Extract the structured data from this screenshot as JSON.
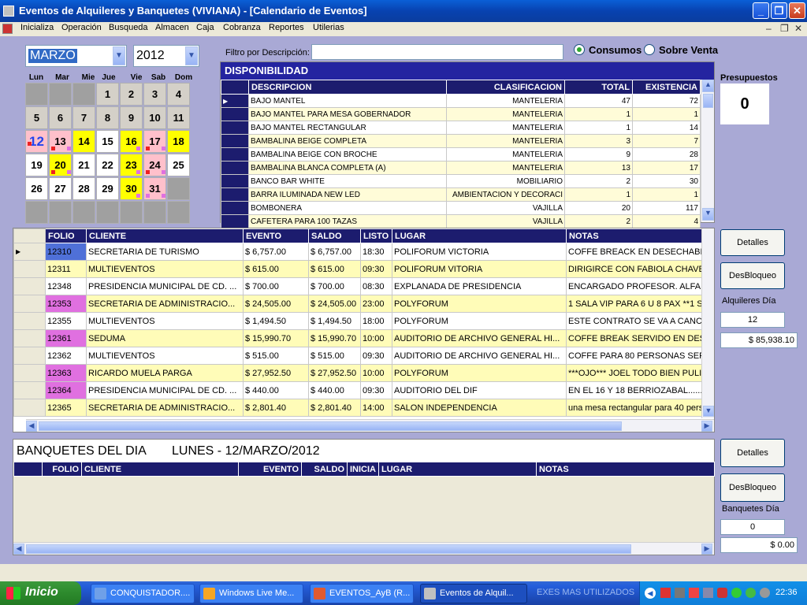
{
  "window": {
    "title": "Eventos de Alquileres y Banquetes  (VIVIANA) - [Calendario de Eventos]",
    "min": "_",
    "max": "❐",
    "close": "✕"
  },
  "menu": [
    "Inicializa",
    "Operación",
    "Busqueda",
    "Almacen",
    "Caja",
    "Cobranza",
    "Reportes",
    "Utilerias"
  ],
  "calendar": {
    "month": "MARZO",
    "year": "2012",
    "weekdays": [
      "Lun",
      "Mar",
      "Mie",
      "Jue",
      "Vie",
      "Sab",
      "Dom"
    ],
    "weeks": [
      [
        "",
        "",
        "",
        "1",
        "2",
        "3",
        "4"
      ],
      [
        "5",
        "6",
        "7",
        "8",
        "9",
        "10",
        "11"
      ],
      [
        "12",
        "13",
        "14",
        "15",
        "16",
        "17",
        "18"
      ],
      [
        "19",
        "20",
        "21",
        "22",
        "23",
        "24",
        "25"
      ],
      [
        "26",
        "27",
        "28",
        "29",
        "30",
        "31",
        ""
      ],
      [
        "",
        "",
        "",
        "",
        "",
        "",
        ""
      ]
    ]
  },
  "filter": {
    "label": "Filtro por Descripción:",
    "value": ""
  },
  "mode": {
    "option1": "Consumos",
    "option2": "Sobre Venta",
    "selected": "Consumos"
  },
  "disponibilidad": {
    "title": "DISPONIBILIDAD",
    "headers": [
      "DESCRIPCION",
      "CLASIFICACION",
      "TOTAL",
      "EXISTENCIA"
    ],
    "rows": [
      [
        "BAJO MANTEL",
        "MANTELERIA",
        "47",
        "72"
      ],
      [
        "BAJO MANTEL PARA MESA GOBERNADOR",
        "MANTELERIA",
        "1",
        "1"
      ],
      [
        "BAJO MANTEL RECTANGULAR",
        "MANTELERIA",
        "1",
        "14"
      ],
      [
        "BAMBALINA BEIGE COMPLETA",
        "MANTELERIA",
        "3",
        "7"
      ],
      [
        "BAMBALINA BEIGE CON BROCHE",
        "MANTELERIA",
        "9",
        "28"
      ],
      [
        "BAMBALINA BLANCA COMPLETA (A)",
        "MANTELERIA",
        "13",
        "17"
      ],
      [
        "BANCO BAR WHITE",
        "MOBILIARIO",
        "2",
        "30"
      ],
      [
        "BARRA ILUMINADA NEW LED",
        "AMBIENTACION Y DECORACI",
        "1",
        "1"
      ],
      [
        "BOMBONERA",
        "VAJILLA",
        "20",
        "117"
      ],
      [
        "CAFETERA PARA 100 TAZAS",
        "VAJILLA",
        "2",
        "4"
      ]
    ]
  },
  "presupuestos": {
    "label": "Presupuestos",
    "value": "0"
  },
  "events": {
    "headers": [
      "FOLIO",
      "CLIENTE",
      "EVENTO",
      "SALDO",
      "LISTO",
      "LUGAR",
      "NOTAS"
    ],
    "rows": [
      {
        "folio": "12310",
        "cliente": "SECRETARIA DE TURISMO",
        "evento": "$ 6,757.00",
        "saldo": "$ 6,757.00",
        "listo": "18:30",
        "lugar": "POLIFORUM VICTORIA",
        "notas": "COFFE BREACK EN DESECHABL",
        "fc": "#4f70d8"
      },
      {
        "folio": "12311",
        "cliente": "MULTIEVENTOS",
        "evento": "$ 615.00",
        "saldo": "$ 615.00",
        "listo": "09:30",
        "lugar": "POLIFORUM VITORIA",
        "notas": "DIRIGIRCE CON FABIOLA CHAVE",
        "fc": ""
      },
      {
        "folio": "12348",
        "cliente": "PRESIDENCIA MUNICIPAL DE CD. ...",
        "evento": "$ 700.00",
        "saldo": "$ 700.00",
        "listo": "08:30",
        "lugar": "EXPLANADA DE PRESIDENCIA",
        "notas": "ENCARGADO PROFESOR. ALFAD",
        "fc": ""
      },
      {
        "folio": "12353",
        "cliente": "SECRETARIA DE ADMINISTRACIO...",
        "evento": "$ 24,505.00",
        "saldo": "$ 24,505.00",
        "listo": "23:00",
        "lugar": "POLYFORUM",
        "notas": "1 SALA VIP PARA 6 U 8 PAX **1 S",
        "fc": "#e070e0"
      },
      {
        "folio": "12355",
        "cliente": "MULTIEVENTOS",
        "evento": "$ 1,494.50",
        "saldo": "$ 1,494.50",
        "listo": "18:00",
        "lugar": "POLYFORUM",
        "notas": "ESTE CONTRATO SE VA A CANC",
        "fc": ""
      },
      {
        "folio": "12361",
        "cliente": "SEDUMA",
        "evento": "$ 15,990.70",
        "saldo": "$ 15,990.70",
        "listo": "10:00",
        "lugar": "AUDITORIO DE ARCHIVO GENERAL HI...",
        "notas": "COFFE BREAK SERVIDO EN DES",
        "fc": "#e070e0"
      },
      {
        "folio": "12362",
        "cliente": "MULTIEVENTOS",
        "evento": "$ 515.00",
        "saldo": "$ 515.00",
        "listo": "09:30",
        "lugar": "AUDITORIO DE ARCHIVO GENERAL HI...",
        "notas": "COFFE PARA 80 PERSONAS SER",
        "fc": ""
      },
      {
        "folio": "12363",
        "cliente": "RICARDO MUELA PARGA",
        "evento": "$ 27,952.50",
        "saldo": "$ 27,952.50",
        "listo": "10:00",
        "lugar": "POLYFORUM",
        "notas": "***OJO*** JOEL TODO BIEN PULID",
        "fc": "#e070e0"
      },
      {
        "folio": "12364",
        "cliente": "PRESIDENCIA MUNICIPAL DE CD. ...",
        "evento": "$ 440.00",
        "saldo": "$ 440.00",
        "listo": "09:30",
        "lugar": "AUDITORIO DEL DIF",
        "notas": "EN EL 16 Y 18 BERRIOZABAL......",
        "fc": "#e070e0"
      },
      {
        "folio": "12365",
        "cliente": "SECRETARIA DE ADMINISTRACIO...",
        "evento": "$ 2,801.40",
        "saldo": "$ 2,801.40",
        "listo": "14:00",
        "lugar": "SALON INDEPENDENCIA",
        "notas": "una mesa rectangular para 40 perso",
        "fc": ""
      }
    ]
  },
  "side1": {
    "detalles": "Detalles",
    "desbloqueo": "DesBloqueo",
    "label": "Alquileres Día",
    "count": "12",
    "amount": "$ 85,938.10"
  },
  "banquetes": {
    "title": "BANQUETES DEL DIA",
    "date": "LUNES - 12/MARZO/2012",
    "headers": [
      "FOLIO",
      "CLIENTE",
      "EVENTO",
      "SALDO",
      "INICIA",
      "LUGAR",
      "NOTAS"
    ]
  },
  "side2": {
    "detalles": "Detalles",
    "desbloqueo": "DesBloqueo",
    "label": "Banquetes Día",
    "count": "0",
    "amount": "$ 0.00"
  },
  "taskbar": {
    "start": "Inicio",
    "items": [
      "CONQUISTADOR....",
      "Windows Live Me...",
      "EVENTOS_AyB (R...",
      "Eventos de Alquil...",
      "EXES MAS UTILIZADOS"
    ],
    "clock": "22:36"
  }
}
